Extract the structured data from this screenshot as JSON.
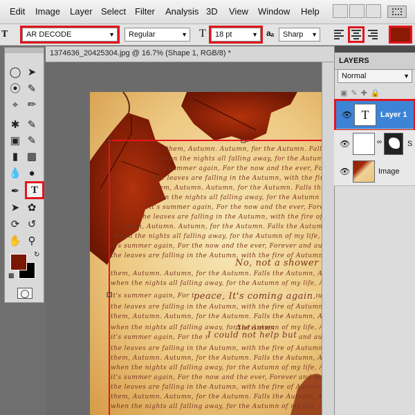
{
  "menu": {
    "items": [
      "Edit",
      "Image",
      "Layer",
      "Select",
      "Filter",
      "Analysis",
      "3D",
      "View",
      "Window",
      "Help"
    ]
  },
  "options": {
    "font_family": "AR DECODE",
    "font_style": "Regular",
    "font_size": "18 pt",
    "antialias": "Sharp",
    "aa_label": "aₐ",
    "text_color": "#8b1a05",
    "highlight_color": "#e3141d"
  },
  "document": {
    "tab_title": "1374636_20425304.jpg @ 16.7% (Shape 1, RGB/8) *"
  },
  "canvas_text": {
    "headline_1": "No, not a shower",
    "headline_2": "peace, It's coming again.",
    "headline_3": "Autumns",
    "headline_4": "I could not help but",
    "line_1": "them, Autumn. Autumn, for the Autumn. Falls the Autumn, And the Autumn, I want",
    "line_2": "when the nights all falling away, for the Autumn of my life, And I know",
    "line_3": "it's summer again, For the now and the ever, Forever and autumn again",
    "line_4": "the leaves are falling in the Autumn, with the fire of Autumn"
  },
  "layers_panel": {
    "title": "LAYERS",
    "blend_mode": "Normal",
    "layers": [
      {
        "name": "Layer 1",
        "type": "text"
      },
      {
        "name": "S",
        "type": "shape"
      },
      {
        "name": "Image",
        "type": "image"
      }
    ]
  },
  "toolbox": {
    "foreground_color": "#7a1705",
    "background_color": "#000000"
  }
}
